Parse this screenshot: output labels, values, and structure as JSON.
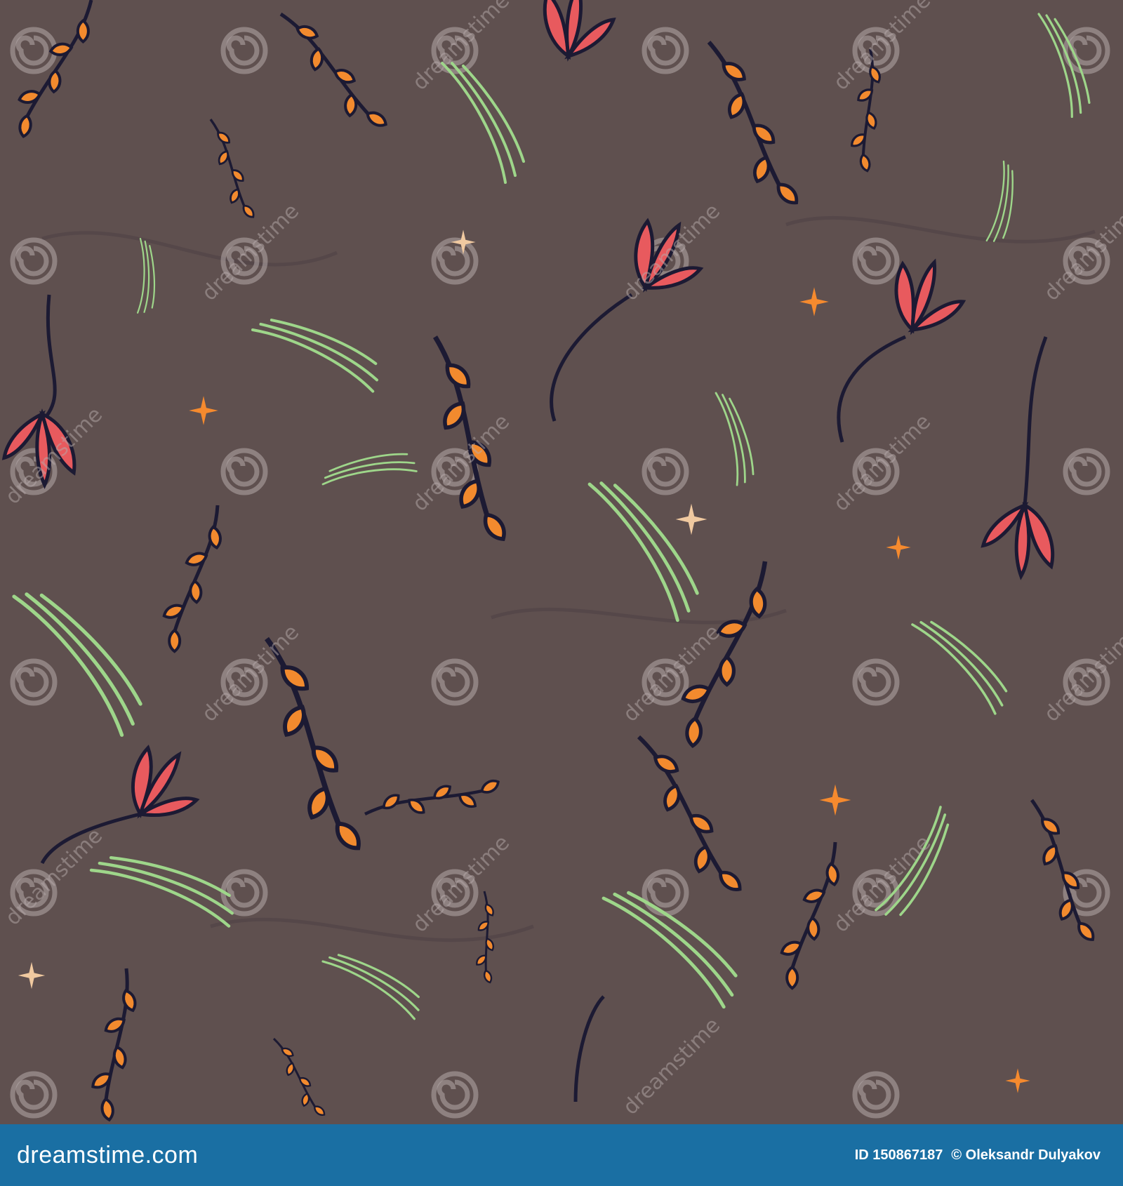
{
  "pattern": {
    "background": "#5f504f",
    "colors": {
      "stem": "#1c1a33",
      "leaf_fill": "#f28a2e",
      "petal": "#e85a5e",
      "grass": "#9ed68a",
      "star_orange": "#f58a2e",
      "star_cream": "#f0c9a0"
    },
    "watermark_text": "dreamstime",
    "watermark_icon": "dreamstime-spiral-icon"
  },
  "footer": {
    "background": "#1a6fa3",
    "brand": "dreamstime.com",
    "image_id": "ID 150867187",
    "author": "© Oleksandr Dulyakov"
  }
}
